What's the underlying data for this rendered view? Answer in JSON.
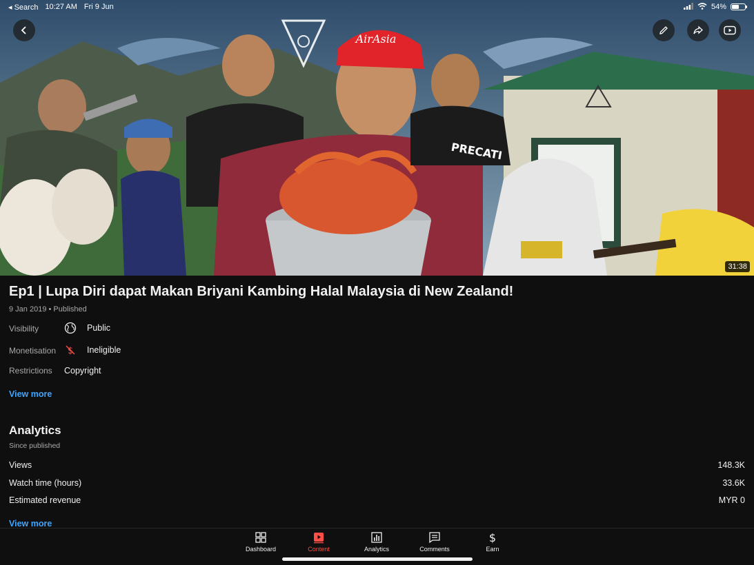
{
  "status_bar": {
    "back_app": "Search",
    "time": "10:27 AM",
    "date": "Fri 9 Jun",
    "battery": "54%",
    "battery_level": 0.54
  },
  "hero": {
    "duration": "31:38",
    "cap_text": "AirAsia",
    "shirt_text": "PRECATI"
  },
  "video": {
    "title": "Ep1 | Lupa Diri dapat Makan Briyani Kambing Halal Malaysia di New Zealand!",
    "date": "9 Jan 2019",
    "separator": "•",
    "status": "Published"
  },
  "details": {
    "visibility_label": "Visibility",
    "visibility_value": "Public",
    "monetisation_label": "Monetisation",
    "monetisation_value": "Ineligible",
    "restrictions_label": "Restrictions",
    "restrictions_value": "Copyright",
    "view_more": "View more"
  },
  "analytics": {
    "title": "Analytics",
    "subtitle": "Since published",
    "rows": [
      {
        "label": "Views",
        "value": "148.3K"
      },
      {
        "label": "Watch time (hours)",
        "value": "33.6K"
      },
      {
        "label": "Estimated revenue",
        "value": "MYR 0"
      }
    ],
    "view_more": "View more"
  },
  "nav": [
    {
      "label": "Dashboard",
      "icon": "dashboard-icon"
    },
    {
      "label": "Content",
      "icon": "content-icon",
      "active": true
    },
    {
      "label": "Analytics",
      "icon": "analytics-icon"
    },
    {
      "label": "Comments",
      "icon": "comments-icon"
    },
    {
      "label": "Earn",
      "icon": "dollar-icon"
    }
  ],
  "colors": {
    "background": "#0f0f0f",
    "accent_red": "#ff4e45",
    "link_blue": "#3ea6ff"
  }
}
